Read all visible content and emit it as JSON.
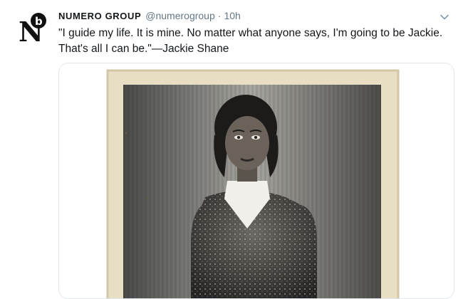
{
  "tweet": {
    "display_name": "NUMERO GROUP",
    "handle": "@numerogroup",
    "separator": "·",
    "time": "10h",
    "text": "\"I guide my life. It is mine. No matter what anyone says, I'm going to be Jackie. That's all I can be.\"—Jackie Shane",
    "avatar_icon": "numero-group-logo-icon",
    "menu_icon": "chevron-down-icon"
  },
  "colors": {
    "text": "#14171a",
    "secondary": "#657786",
    "border": "#e1e8ed",
    "paper": "#e9dfc6"
  }
}
